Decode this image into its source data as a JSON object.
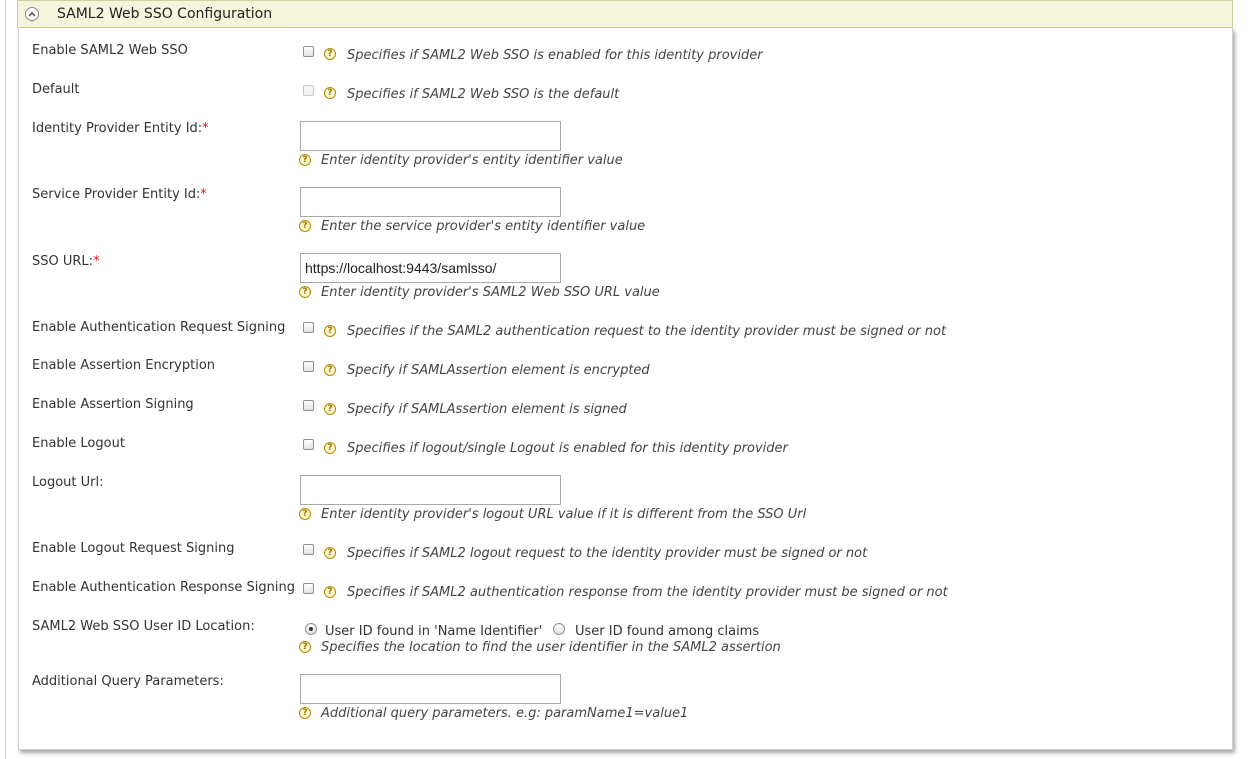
{
  "panel": {
    "title": "SAML2 Web SSO Configuration",
    "collapse_icon": "chevron-up-icon"
  },
  "required_marker": "*",
  "help_glyph": "?",
  "fields": {
    "enable_sso": {
      "label": "Enable SAML2 Web SSO",
      "hint": "Specifies if SAML2 Web SSO is enabled for this identity provider",
      "checked": false
    },
    "default": {
      "label": "Default",
      "hint": "Specifies if SAML2 Web SSO is the default",
      "checked": false,
      "disabled": true
    },
    "idp_entity_id": {
      "label": "Identity Provider Entity Id:",
      "value": "",
      "hint": "Enter identity provider's entity identifier value"
    },
    "sp_entity_id": {
      "label": "Service Provider Entity Id:",
      "value": "",
      "hint": "Enter the service provider's entity identifier value"
    },
    "sso_url": {
      "label": "SSO URL:",
      "value": "https://localhost:9443/samlsso/",
      "hint": "Enter identity provider's SAML2 Web SSO URL value"
    },
    "authn_request_signing": {
      "label": "Enable Authentication Request Signing",
      "hint": "Specifies if the SAML2 authentication request to the identity provider must be signed or not",
      "checked": false
    },
    "assertion_encryption": {
      "label": "Enable Assertion Encryption",
      "hint": "Specify if SAMLAssertion element is encrypted",
      "checked": false
    },
    "assertion_signing": {
      "label": "Enable Assertion Signing",
      "hint": "Specify if SAMLAssertion element is signed",
      "checked": false
    },
    "logout": {
      "label": "Enable Logout",
      "hint": "Specifies if logout/single Logout is enabled for this identity provider",
      "checked": false
    },
    "logout_url": {
      "label": "Logout Url:",
      "value": "",
      "hint": "Enter identity provider's logout URL value if it is different from the SSO Url"
    },
    "logout_request_signing": {
      "label": "Enable Logout Request Signing",
      "hint": "Specifies if SAML2 logout request to the identity provider must be signed or not",
      "checked": false
    },
    "authn_response_signing": {
      "label": "Enable Authentication Response Signing",
      "hint": "Specifies if SAML2 authentication response from the identity provider must be signed or not",
      "checked": false
    },
    "user_id_location": {
      "label": "SAML2 Web SSO User ID Location:",
      "options": [
        "User ID found in 'Name Identifier'",
        "User ID found among claims"
      ],
      "selected": "User ID found in 'Name Identifier'",
      "hint": "Specifies the location to find the user identifier in the SAML2 assertion"
    },
    "query_params": {
      "label": "Additional Query Parameters:",
      "value": "",
      "hint": "Additional query parameters. e.g: paramName1=value1"
    }
  }
}
